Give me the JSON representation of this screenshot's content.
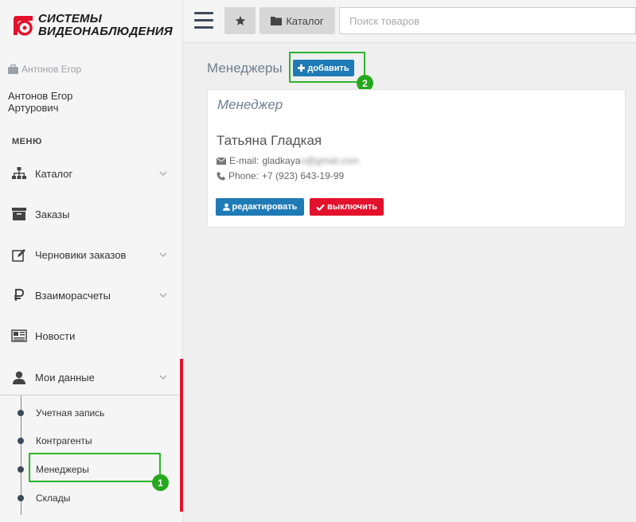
{
  "brand": {
    "line1": "СИСТЕМЫ",
    "line2": "ВИДЕОНАБЛЮДЕНИЯ",
    "color": "#e3112c"
  },
  "user": {
    "short_name": "Антонов Егор",
    "full_name": "Антонов Егор Артурович",
    "icon": "briefcase-icon"
  },
  "sidebar": {
    "menu_title": "МЕНЮ",
    "items": [
      {
        "label": "Каталог",
        "icon": "sitemap-icon",
        "has_children": true
      },
      {
        "label": "Заказы",
        "icon": "archive-box-icon",
        "has_children": false
      },
      {
        "label": "Черновики заказов",
        "icon": "edit-icon",
        "has_children": true
      },
      {
        "label": "Взаиморасчеты",
        "icon": "ruble-icon",
        "has_children": true
      },
      {
        "label": "Новости",
        "icon": "newspaper-icon",
        "has_children": false
      },
      {
        "label": "Мои данные",
        "icon": "user-icon",
        "has_children": true,
        "expanded": true
      }
    ],
    "submenu": [
      {
        "label": "Учетная запись"
      },
      {
        "label": "Контрагенты"
      },
      {
        "label": "Менеджеры",
        "active": true
      },
      {
        "label": "Склады"
      }
    ],
    "active_color": "#e3112c"
  },
  "topbar": {
    "catalog_label": "Каталог",
    "search_placeholder": "Поиск товаров"
  },
  "main": {
    "page_title": "Менеджеры",
    "add_label": "добавить",
    "card": {
      "heading": "Менеджер",
      "name": "Татьяна Гладкая",
      "email_label": "E-mail:",
      "email_visible": "gladkaya",
      "email_hidden": "n@gmail.com",
      "phone_label": "Phone:",
      "phone": "+7 (923) 643-19-99",
      "edit_label": "редактировать",
      "disable_label": "выключить"
    }
  },
  "annotations": {
    "badge1": "1",
    "badge2": "2",
    "color": "#2bb52b"
  }
}
